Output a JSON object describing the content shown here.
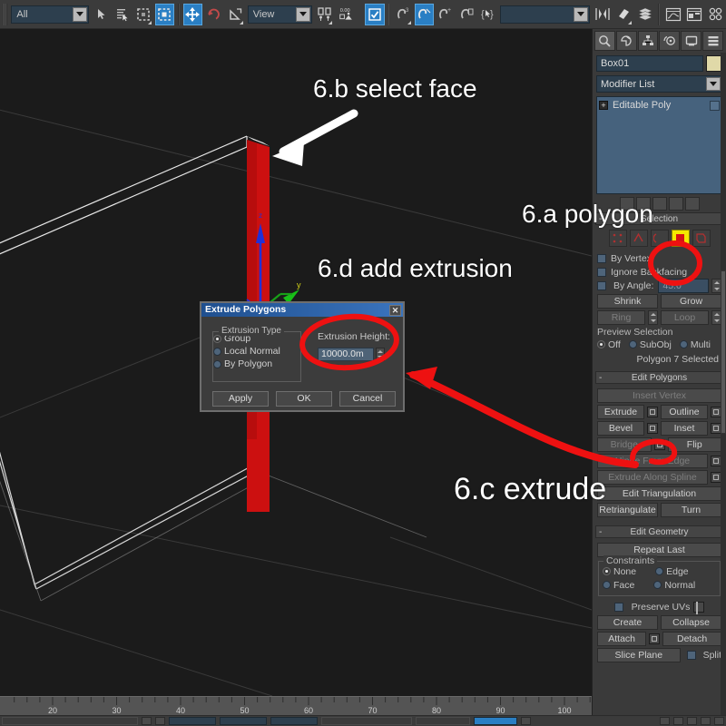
{
  "toolbar": {
    "selection_filter": "All",
    "reference_coord_system": "View",
    "named_selection_sets": "",
    "buttons": [
      {
        "name": "select-object",
        "icon": "arrow-cursor-icon"
      },
      {
        "name": "select-by-name",
        "icon": "select-by-name-icon"
      },
      {
        "name": "rectangular-selection-region",
        "icon": "rect-select-icon"
      },
      {
        "name": "window-crossing",
        "icon": "window-crossing-icon"
      },
      {
        "name": "select-and-move",
        "icon": "move-gizmo-icon"
      },
      {
        "name": "select-and-rotate",
        "icon": "rotate-icon"
      },
      {
        "name": "select-and-scale",
        "icon": "scale-icon"
      },
      {
        "name": "use-center-flyout",
        "icon": "pivot-center-icon"
      },
      {
        "name": "snaps-toggle",
        "icon": "snap-3d-icon"
      },
      {
        "name": "angle-snap-toggle",
        "icon": "angle-snap-icon"
      },
      {
        "name": "percent-snap-toggle",
        "icon": "percent-snap-icon"
      },
      {
        "name": "spinner-snap-toggle",
        "icon": "spinner-snap-icon"
      },
      {
        "name": "edit-named-selection-sets",
        "icon": "named-sets-icon"
      },
      {
        "name": "mirror",
        "icon": "mirror-icon"
      },
      {
        "name": "align",
        "icon": "align-icon"
      },
      {
        "name": "layer-manager",
        "icon": "layers-icon"
      },
      {
        "name": "curve-editor",
        "icon": "curve-editor-icon"
      },
      {
        "name": "schematic-view",
        "icon": "schematic-view-icon"
      },
      {
        "name": "material-editor",
        "icon": "material-editor-icon"
      }
    ],
    "spinner_snap_value": "0.00"
  },
  "command_panel": {
    "tabs": [
      {
        "name": "create",
        "icon": "create-tab-icon"
      },
      {
        "name": "modify",
        "icon": "modify-tab-icon"
      },
      {
        "name": "hierarchy",
        "icon": "hierarchy-tab-icon"
      },
      {
        "name": "motion",
        "icon": "motion-tab-icon"
      },
      {
        "name": "display",
        "icon": "display-tab-icon"
      },
      {
        "name": "utilities",
        "icon": "utilities-tab-icon"
      }
    ],
    "object_name": "Box01",
    "modifier_list_label": "Modifier List",
    "modifier_stack": [
      {
        "label": "Editable Poly"
      }
    ],
    "selection": {
      "title": "Selection",
      "subobject_modes": [
        "vertex",
        "edge",
        "border",
        "polygon",
        "element"
      ],
      "selected_subobject": "polygon",
      "by_vertex": "By Vertex",
      "ignore_backfacing": "Ignore Backfacing",
      "by_angle": "By Angle:",
      "by_angle_value": "45.0",
      "shrink": "Shrink",
      "grow": "Grow",
      "ring": "Ring",
      "loop": "Loop",
      "preview_selection": "Preview Selection",
      "preview_options": [
        "Off",
        "SubObj",
        "Multi"
      ],
      "preview_selected": "Off",
      "status": "Polygon 7 Selected"
    },
    "edit_polygons": {
      "title": "Edit Polygons",
      "insert_vertex": "Insert Vertex",
      "extrude": "Extrude",
      "outline": "Outline",
      "bevel": "Bevel",
      "inset": "Inset",
      "bridge": "Bridge",
      "flip": "Flip",
      "hinge_from_edge": "Hinge From Edge",
      "extrude_along_spline": "Extrude Along Spline",
      "edit_triangulation": "Edit Triangulation",
      "retriangulate": "Retriangulate",
      "turn": "Turn"
    },
    "edit_geometry": {
      "title": "Edit Geometry",
      "repeat_last": "Repeat Last",
      "constraints_label": "Constraints",
      "constraints": [
        "None",
        "Edge",
        "Face",
        "Normal"
      ],
      "constraint_selected": "None",
      "preserve_uvs": "Preserve UVs",
      "create": "Create",
      "collapse": "Collapse",
      "attach": "Attach",
      "detach": "Detach",
      "slice_plane": "Slice Plane",
      "split": "Split"
    }
  },
  "extrude_dialog": {
    "title": "Extrude Polygons",
    "close_label": "✕",
    "extrusion_type_label": "Extrusion Type",
    "extrusion_type_options": [
      "Group",
      "Local Normal",
      "By Polygon"
    ],
    "extrusion_type_selected": "Group",
    "extrusion_height_label": "Extrusion Height:",
    "extrusion_height_value": "10000.0m",
    "apply": "Apply",
    "ok": "OK",
    "cancel": "Cancel"
  },
  "annotations": [
    {
      "id": "a",
      "text": "6.a polygon"
    },
    {
      "id": "b",
      "text": "6.b select face"
    },
    {
      "id": "c",
      "text": "6.c extrude"
    },
    {
      "id": "d",
      "text": "6.d add extrusion"
    }
  ],
  "timeline": {
    "tick_labels": [
      "20",
      "30",
      "40",
      "50",
      "60",
      "70",
      "80",
      "90",
      "100"
    ]
  },
  "colors": {
    "selection_red": "#cc1111",
    "annotation_white": "#ffffff",
    "annotation_red": "#ee1111",
    "highlight_yellow": "#f5e800",
    "accent_blue": "#2a7fc4",
    "panel_gray": "#3a3a3a",
    "viewport_black": "#1b1b1b"
  }
}
